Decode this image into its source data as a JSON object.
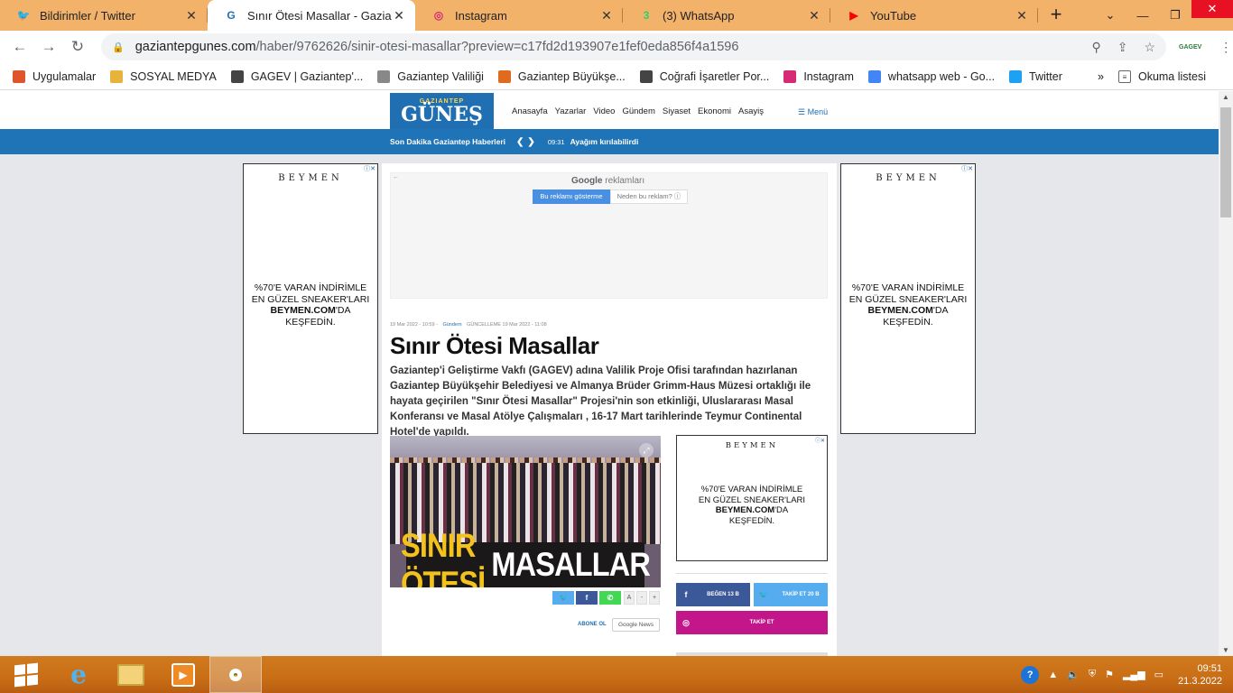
{
  "browser": {
    "tabs": [
      {
        "title": "Bildirimler / Twitter",
        "icon": "twitter-icon",
        "color": "#1da1f2",
        "glyph": "🐦",
        "active": false
      },
      {
        "title": "Sınır Ötesi Masallar - Gazianteµ",
        "icon": "gazete-icon",
        "color": "#1f6fb2",
        "glyph": "G",
        "active": true
      },
      {
        "title": "Instagram",
        "icon": "instagram-icon",
        "color": "#d62976",
        "glyph": "◎",
        "active": false
      },
      {
        "title": "(3) WhatsApp",
        "icon": "whatsapp-icon",
        "color": "#25d366",
        "glyph": "3",
        "active": false
      },
      {
        "title": "YouTube",
        "icon": "youtube-icon",
        "color": "#ff0000",
        "glyph": "▶",
        "active": false
      }
    ],
    "url_host": "gaziantepgunes.com",
    "url_path": "/haber/9762626/sinir-otesi-masallar?preview=c17fd2d193907e1fef0eda856f4a1596",
    "profile_label": "GAGEV",
    "bookmarks": [
      {
        "label": "Uygulamalar",
        "icon": "apps-grid-icon",
        "color": "#e0542b"
      },
      {
        "label": "SOSYAL MEDYA",
        "icon": "folder-icon",
        "color": "#e8b33a"
      },
      {
        "label": "GAGEV | Gaziantep'...",
        "icon": "globe-icon",
        "color": "#444"
      },
      {
        "label": "Gaziantep Valiliği",
        "icon": "valilik-icon",
        "color": "#888"
      },
      {
        "label": "Gaziantep Büyükşe...",
        "icon": "buyuksehir-icon",
        "color": "#e06b1f"
      },
      {
        "label": "Coğrafi İşaretler Por...",
        "icon": "globe-icon",
        "color": "#444"
      },
      {
        "label": "Instagram",
        "icon": "instagram-icon",
        "color": "#d62976"
      },
      {
        "label": "whatsapp web - Go...",
        "icon": "google-icon",
        "color": "#4285f4"
      },
      {
        "label": "Twitter",
        "icon": "twitter-icon",
        "color": "#1da1f2"
      }
    ],
    "reading_list": "Okuma listesi"
  },
  "site": {
    "logo_small": "GAZIANTEP",
    "logo_big": "GÜNEŞ",
    "nav": [
      "Anasayfa",
      "Yazarlar",
      "Video",
      "Gündem",
      "Siyaset",
      "Ekonomi",
      "Asayiş"
    ],
    "menu_label": "Menü",
    "breaking_label": "Son Dakika Gaziantep Haberleri",
    "breaking_time": "09:31",
    "breaking_text": "Ayağım kırılabilirdi"
  },
  "ads": {
    "brand": "BEYMEN",
    "line1": "%70'E VARAN İNDİRİMLE",
    "line2": "EN GÜZEL SNEAKER'LARI",
    "line3_bold": "BEYMEN.COM",
    "line3_rest": "'DA",
    "line4": "KEŞFEDİN.",
    "google_label_brand": "Google",
    "google_label_rest": "reklamları",
    "google_btn1": "Bu reklamı gösterme",
    "google_btn2": "Neden bu reklam? ⓘ"
  },
  "article": {
    "date": "19 Mar 2022 - 10:59",
    "category": "Gündem",
    "updated": "GÜNCELLEME 19 Mar 2022 - 11:08",
    "title": "Sınır Ötesi Masallar",
    "lead": "Gaziantep'i Geliştirme Vakfı (GAGEV) adına Valilik Proje Ofisi tarafından hazırlanan Gaziantep Büyükşehir Belediyesi ve Almanya Brüder Grimm-Haus Müzesi ortaklığı ile hayata geçirilen \"Sınır Ötesi Masallar\" Projesi'nin son etkinliği, Uluslararası Masal Konferansı ve Masal Atölye Çalışmaları , 16-17 Mart tarihlerinde Teymur Continental Hotel'de yapıldı.",
    "photo_text_yellow": "SINIR ÖTESİ",
    "photo_text_white": "MASALLAR",
    "font_controls": [
      "A",
      "-",
      "+"
    ],
    "subscribe_label": "ABONE OL",
    "google_news": "Google News"
  },
  "social": {
    "facebook": "BEĞEN 13 B",
    "twitter": "TAKİP ET 20 B",
    "instagram": "TAKİP ET",
    "colors": {
      "facebook": "#3b5998",
      "twitter": "#55acee",
      "instagram": "#c2168a",
      "whatsapp": "#43d854"
    }
  },
  "taskbar": {
    "time": "09:51",
    "date": "21.3.2022"
  }
}
